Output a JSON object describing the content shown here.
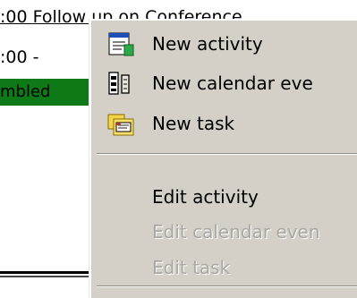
{
  "background": {
    "line1": ":00 Follow up on Conference",
    "line2": ":00 -",
    "line3": "mbled"
  },
  "menu": {
    "new_activity": "New activity",
    "new_calendar_event": "New calendar eve",
    "new_task": "New task",
    "edit_activity": "Edit activity",
    "edit_calendar_event": "Edit calendar even",
    "edit_task": "Edit task"
  },
  "colors": {
    "menu_bg": "#d4d0c8",
    "highlight_green": "#0d7a17",
    "disabled_text": "#a9a7a1"
  }
}
